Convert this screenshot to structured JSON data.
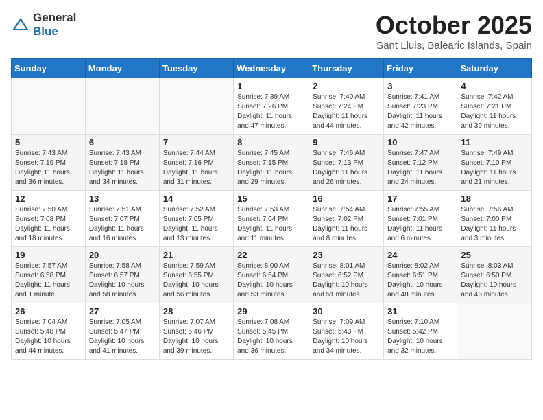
{
  "header": {
    "logo_general": "General",
    "logo_blue": "Blue",
    "month_title": "October 2025",
    "location": "Sant Lluis, Balearic Islands, Spain"
  },
  "weekdays": [
    "Sunday",
    "Monday",
    "Tuesday",
    "Wednesday",
    "Thursday",
    "Friday",
    "Saturday"
  ],
  "weeks": [
    [
      {
        "day": "",
        "info": ""
      },
      {
        "day": "",
        "info": ""
      },
      {
        "day": "",
        "info": ""
      },
      {
        "day": "1",
        "info": "Sunrise: 7:39 AM\nSunset: 7:26 PM\nDaylight: 11 hours\nand 47 minutes."
      },
      {
        "day": "2",
        "info": "Sunrise: 7:40 AM\nSunset: 7:24 PM\nDaylight: 11 hours\nand 44 minutes."
      },
      {
        "day": "3",
        "info": "Sunrise: 7:41 AM\nSunset: 7:23 PM\nDaylight: 11 hours\nand 42 minutes."
      },
      {
        "day": "4",
        "info": "Sunrise: 7:42 AM\nSunset: 7:21 PM\nDaylight: 11 hours\nand 39 minutes."
      }
    ],
    [
      {
        "day": "5",
        "info": "Sunrise: 7:43 AM\nSunset: 7:19 PM\nDaylight: 11 hours\nand 36 minutes."
      },
      {
        "day": "6",
        "info": "Sunrise: 7:43 AM\nSunset: 7:18 PM\nDaylight: 11 hours\nand 34 minutes."
      },
      {
        "day": "7",
        "info": "Sunrise: 7:44 AM\nSunset: 7:16 PM\nDaylight: 11 hours\nand 31 minutes."
      },
      {
        "day": "8",
        "info": "Sunrise: 7:45 AM\nSunset: 7:15 PM\nDaylight: 11 hours\nand 29 minutes."
      },
      {
        "day": "9",
        "info": "Sunrise: 7:46 AM\nSunset: 7:13 PM\nDaylight: 11 hours\nand 26 minutes."
      },
      {
        "day": "10",
        "info": "Sunrise: 7:47 AM\nSunset: 7:12 PM\nDaylight: 11 hours\nand 24 minutes."
      },
      {
        "day": "11",
        "info": "Sunrise: 7:49 AM\nSunset: 7:10 PM\nDaylight: 11 hours\nand 21 minutes."
      }
    ],
    [
      {
        "day": "12",
        "info": "Sunrise: 7:50 AM\nSunset: 7:08 PM\nDaylight: 11 hours\nand 18 minutes."
      },
      {
        "day": "13",
        "info": "Sunrise: 7:51 AM\nSunset: 7:07 PM\nDaylight: 11 hours\nand 16 minutes."
      },
      {
        "day": "14",
        "info": "Sunrise: 7:52 AM\nSunset: 7:05 PM\nDaylight: 11 hours\nand 13 minutes."
      },
      {
        "day": "15",
        "info": "Sunrise: 7:53 AM\nSunset: 7:04 PM\nDaylight: 11 hours\nand 11 minutes."
      },
      {
        "day": "16",
        "info": "Sunrise: 7:54 AM\nSunset: 7:02 PM\nDaylight: 11 hours\nand 8 minutes."
      },
      {
        "day": "17",
        "info": "Sunrise: 7:55 AM\nSunset: 7:01 PM\nDaylight: 11 hours\nand 6 minutes."
      },
      {
        "day": "18",
        "info": "Sunrise: 7:56 AM\nSunset: 7:00 PM\nDaylight: 11 hours\nand 3 minutes."
      }
    ],
    [
      {
        "day": "19",
        "info": "Sunrise: 7:57 AM\nSunset: 6:58 PM\nDaylight: 11 hours\nand 1 minute."
      },
      {
        "day": "20",
        "info": "Sunrise: 7:58 AM\nSunset: 6:57 PM\nDaylight: 10 hours\nand 58 minutes."
      },
      {
        "day": "21",
        "info": "Sunrise: 7:59 AM\nSunset: 6:55 PM\nDaylight: 10 hours\nand 56 minutes."
      },
      {
        "day": "22",
        "info": "Sunrise: 8:00 AM\nSunset: 6:54 PM\nDaylight: 10 hours\nand 53 minutes."
      },
      {
        "day": "23",
        "info": "Sunrise: 8:01 AM\nSunset: 6:52 PM\nDaylight: 10 hours\nand 51 minutes."
      },
      {
        "day": "24",
        "info": "Sunrise: 8:02 AM\nSunset: 6:51 PM\nDaylight: 10 hours\nand 48 minutes."
      },
      {
        "day": "25",
        "info": "Sunrise: 8:03 AM\nSunset: 6:50 PM\nDaylight: 10 hours\nand 46 minutes."
      }
    ],
    [
      {
        "day": "26",
        "info": "Sunrise: 7:04 AM\nSunset: 5:48 PM\nDaylight: 10 hours\nand 44 minutes."
      },
      {
        "day": "27",
        "info": "Sunrise: 7:05 AM\nSunset: 5:47 PM\nDaylight: 10 hours\nand 41 minutes."
      },
      {
        "day": "28",
        "info": "Sunrise: 7:07 AM\nSunset: 5:46 PM\nDaylight: 10 hours\nand 39 minutes."
      },
      {
        "day": "29",
        "info": "Sunrise: 7:08 AM\nSunset: 5:45 PM\nDaylight: 10 hours\nand 36 minutes."
      },
      {
        "day": "30",
        "info": "Sunrise: 7:09 AM\nSunset: 5:43 PM\nDaylight: 10 hours\nand 34 minutes."
      },
      {
        "day": "31",
        "info": "Sunrise: 7:10 AM\nSunset: 5:42 PM\nDaylight: 10 hours\nand 32 minutes."
      },
      {
        "day": "",
        "info": ""
      }
    ]
  ]
}
